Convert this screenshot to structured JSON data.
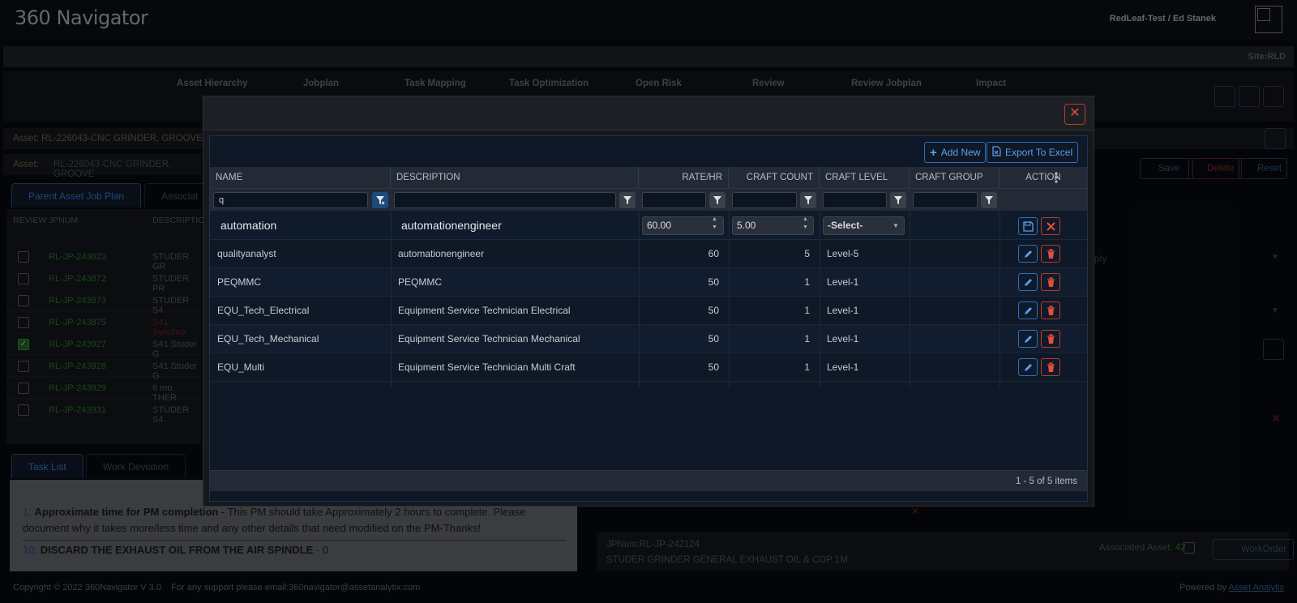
{
  "app": {
    "logo": "360 Navigator",
    "user": "RedLeaf-Test / Ed Stanek",
    "site": "Site:RLD"
  },
  "nav": [
    "Asset Hierarchy",
    "Jobplan",
    "Task Mapping",
    "Task Optimization",
    "Open Risk",
    "Review",
    "Review Jobplan",
    "Impact"
  ],
  "background": {
    "asset_line1": "Asset: RL-226043-CNC GRINDER, GROOVE",
    "asset_label": "Asset:",
    "asset_value": "RL-226043-CNC GRINDER, GROOVE",
    "tab_parent": "Parent Asset Job Plan",
    "tab_assoc": "Associat",
    "col_review": "REVIEW",
    "col_jpnum": "JPNUM",
    "col_desc": "DESCRIPTIO",
    "rows": [
      {
        "jp": "RL-JP-243823",
        "desc": "STUDER GR",
        "checked": false
      },
      {
        "jp": "RL-JP-243872",
        "desc": "STUDER PR",
        "checked": false
      },
      {
        "jp": "RL-JP-243873",
        "desc": "STUDER S4",
        "checked": false
      },
      {
        "jp": "RL-JP-243875",
        "desc": "S41 Synchro",
        "checked": false
      },
      {
        "jp": "RL-JP-243927",
        "desc": "S41 Studer G",
        "checked": true
      },
      {
        "jp": "RL-JP-243928",
        "desc": "S41 Studer G",
        "checked": false
      },
      {
        "jp": "RL-JP-243929",
        "desc": "6 mo. THER",
        "checked": false
      },
      {
        "jp": "RL-JP-243931",
        "desc": "STUDER S4",
        "checked": false
      }
    ],
    "tab_tasklist": "Task List",
    "tab_workdev": "Work Deviation",
    "task1_num": "1:",
    "task1_title": "Approximate time for PM completion",
    "task1_body": " - This PM should take Approximately 2 hours to complete.  Please document why it takes more/less time and any other details that need modified on the PM-Thanks!",
    "task2_num": "10:",
    "task2_title": "DISCARD THE EXHAUST OIL FROM THE AIR SPINDLE",
    "task2_body": " - 0",
    "save": "Save",
    "delete": "Delete",
    "reset": "Reset",
    "jpnum_line": "JPNum:RL-JP-242124",
    "jp_desc": "STUDER GRINDER GENERAL EXHAUST OIL & COP 1M",
    "assoc_label": "Associated Asset:",
    "assoc_count": "42",
    "workorder": "WorkOrder",
    "ply": "ply"
  },
  "footer": {
    "copyright": "Copyright © 2022 360Navigator V 3.0    For any support please email:360navigator@assetanalytix.com",
    "powered": "Powered by",
    "powered_link": "Asset Analytix"
  },
  "modal": {
    "toolbar": {
      "add_new": "Add New",
      "export": "Export To Excel"
    },
    "columns": {
      "name": "NAME",
      "description": "DESCRIPTION",
      "rate": "RATE/HR",
      "craft_count": "CRAFT COUNT",
      "craft_level": "CRAFT LEVEL",
      "craft_group": "CRAFT GROUP",
      "action": "ACTION"
    },
    "filters": {
      "name": "q",
      "description": "",
      "rate": "",
      "craft_count": "",
      "craft_level": "",
      "craft_group": ""
    },
    "edit_row": {
      "name": "automation",
      "description": "automationengineer",
      "rate": "60.00",
      "craft_count": "5.00",
      "craft_level": "-Select-"
    },
    "rows": [
      {
        "name": "qualityanalyst",
        "description": "automationengineer",
        "rate": "60",
        "craft_count": "5",
        "craft_level": "Level-5",
        "craft_group": ""
      },
      {
        "name": "PEQMMC",
        "description": "PEQMMC",
        "rate": "50",
        "craft_count": "1",
        "craft_level": "Level-1",
        "craft_group": ""
      },
      {
        "name": "EQU_Tech_Electrical",
        "description": "Equipment Service Technician Electrical",
        "rate": "50",
        "craft_count": "1",
        "craft_level": "Level-1",
        "craft_group": ""
      },
      {
        "name": "EQU_Tech_Mechanical",
        "description": "Equipment Service Technician Mechanical",
        "rate": "50",
        "craft_count": "1",
        "craft_level": "Level-1",
        "craft_group": ""
      },
      {
        "name": "EQU_Multi",
        "description": "Equipment Service Technician Multi Craft",
        "rate": "50",
        "craft_count": "1",
        "craft_level": "Level-1",
        "craft_group": ""
      }
    ],
    "pager": "1 - 5 of 5 items"
  },
  "colors": {
    "accent_blue": "#2f6fbf",
    "danger_red": "#c0392b",
    "green_link": "#2a8a2a"
  }
}
